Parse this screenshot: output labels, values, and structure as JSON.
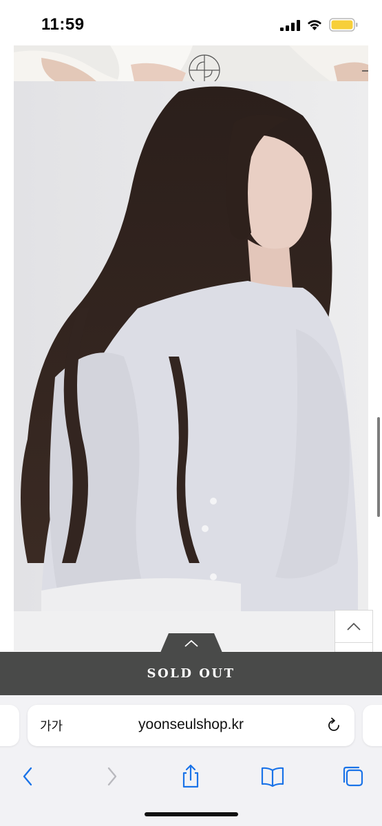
{
  "status_bar": {
    "time": "11:59"
  },
  "page": {
    "brand_logo_icon": "brand-monogram-logo-icon",
    "add_icon": "plus-icon",
    "product_image_alt": "model wearing lavender knit cardigan",
    "scroll_up_icon": "chevron-up-icon",
    "scroll_down_icon": "chevron-down-icon"
  },
  "purchase_bar": {
    "expand_icon": "chevron-up-icon",
    "label": "SOLD OUT",
    "background_color": "#494a49"
  },
  "browser": {
    "text_size_label": "가가",
    "url": "yoonseulshop.kr",
    "toolbar": [
      "back",
      "forward",
      "share",
      "bookmarks",
      "tabs"
    ],
    "accent_color": "#1a73e8"
  }
}
